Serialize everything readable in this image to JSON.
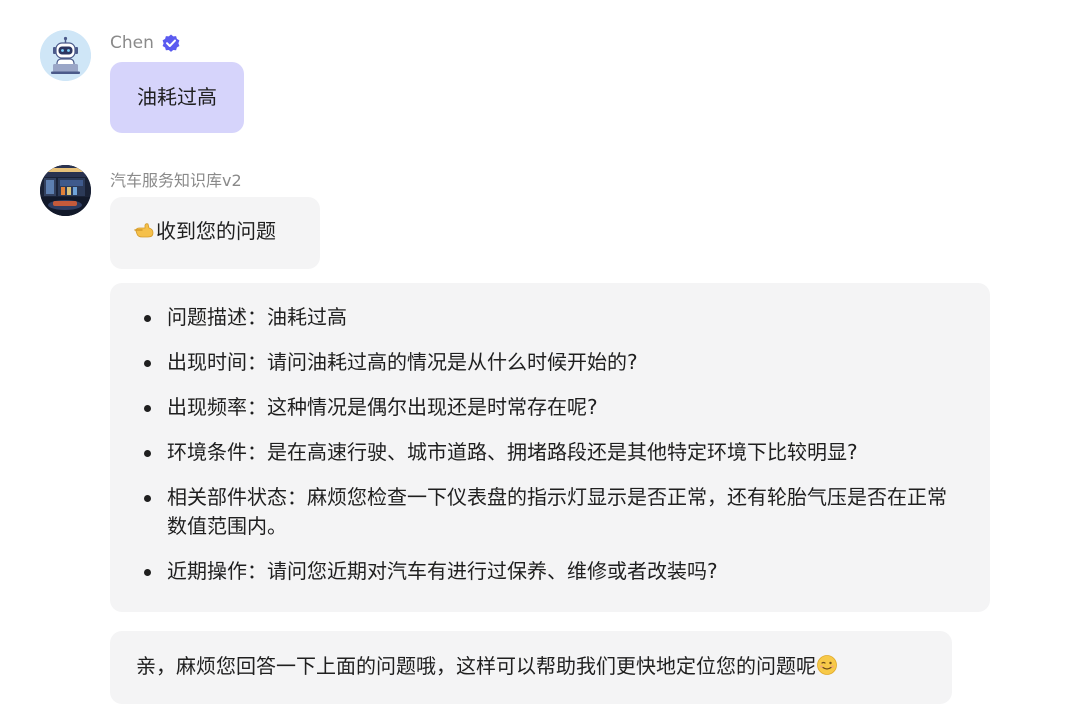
{
  "user_message": {
    "sender": "Chen",
    "text": "油耗过高"
  },
  "bot": {
    "sender": "汽车服务知识库v2",
    "ack": "收到您的问题",
    "questions": [
      {
        "text": "问题描述：油耗过高"
      },
      {
        "text": "出现时间：请问油耗过高的情况是从什么时候开始的?"
      },
      {
        "text": "出现频率：这种情况是偶尔出现还是时常存在呢?"
      },
      {
        "text": "环境条件：是在高速行驶、城市道路、拥堵路段还是其他特定环境下比较明显?"
      },
      {
        "text": "相关部件状态：麻烦您检查一下仪表盘的指示灯显示是否正常，还有轮胎气压是否在正常数值范围内。"
      },
      {
        "text": "近期操作：请问您近期对汽车有进行过保养、维修或者改装吗?"
      }
    ],
    "closing": "亲，麻烦您回答一下上面的问题哦，这样可以帮助我们更快地定位您的问题呢"
  },
  "colors": {
    "user_bubble": "#d6d4fb",
    "bot_bubble": "#f4f4f5",
    "verified_badge": "#5b5bf0",
    "sender_text": "#8a8a8a"
  },
  "icons": {
    "user_avatar": "robot-avatar-icon",
    "bot_avatar": "garage-avatar-icon",
    "verified": "verified-badge-icon",
    "ack_emoji": "pointing-hand-emoji",
    "closing_emoji": "winking-face-emoji"
  }
}
